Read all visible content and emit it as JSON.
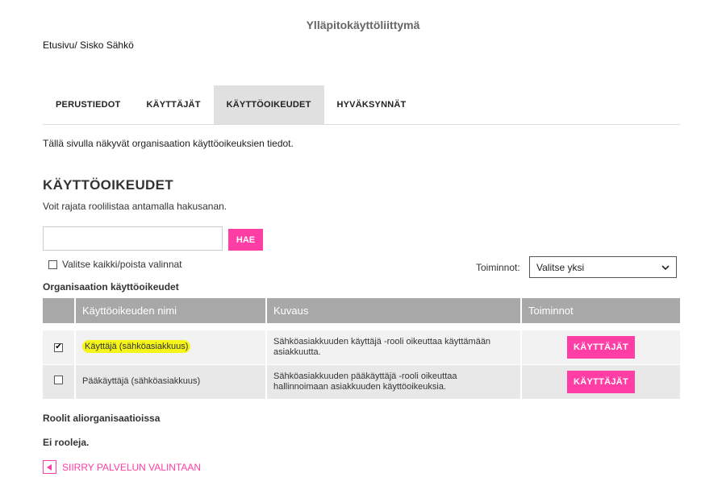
{
  "app": {
    "title": "Ylläpitokäyttöliittymä"
  },
  "breadcrumb": {
    "home": "Etusivu",
    "separator": "/",
    "current": "Sisko Sähkö"
  },
  "tabs": [
    {
      "label": "PERUSTIEDOT",
      "active": false
    },
    {
      "label": "KÄYTTÄJÄT",
      "active": false
    },
    {
      "label": "KÄYTTÖOIKEUDET",
      "active": true
    },
    {
      "label": "HYVÄKSYNNÄT",
      "active": false
    }
  ],
  "intro": "Tällä sivulla näkyvät organisaation käyttöoikeuksien tiedot.",
  "section": {
    "title": "KÄYTTÖOIKEUDET",
    "description": "Voit rajata roolilistaa antamalla hakusanan."
  },
  "search": {
    "value": "",
    "placeholder": "",
    "button_label": "HAE"
  },
  "select_all": {
    "label": "Valitse kaikki/poista valinnat",
    "checked": false
  },
  "actions": {
    "label": "Toiminnot:",
    "selected": "Valitse yksi"
  },
  "table": {
    "title": "Organisaation käyttöoikeudet",
    "columns": [
      "",
      "Käyttöoikeuden nimi",
      "Kuvaus",
      "Toiminnot"
    ],
    "rows": [
      {
        "checked": true,
        "checkmark": "✔",
        "name": "Käyttäjä (sähköasiakkuus)",
        "description": "Sähköasiakkuuden käyttäjä -rooli oikeuttaa käyttämään asiakkuutta.",
        "action_label": "KÄYTTÄJÄT",
        "highlighted": true
      },
      {
        "checked": false,
        "checkmark": "",
        "name": "Pääkäyttäjä (sähköasiakkuus)",
        "description": "Sähköasiakkuuden pääkäyttäjä -rooli oikeuttaa hallinnoimaan asiakkuuden käyttöoikeuksia.",
        "action_label": "KÄYTTÄJÄT",
        "highlighted": false
      }
    ]
  },
  "sub_orgs": {
    "title": "Roolit aliorganisaatioissa",
    "empty_text": "Ei rooleja."
  },
  "back_link": {
    "label": "SIIRRY PALVELUN VALINTAAN",
    "icon": "triangle-left-icon"
  },
  "colors": {
    "accent": "#ff3ea5",
    "header_gray": "#a8a8a8",
    "highlight": "#f5f51a"
  }
}
